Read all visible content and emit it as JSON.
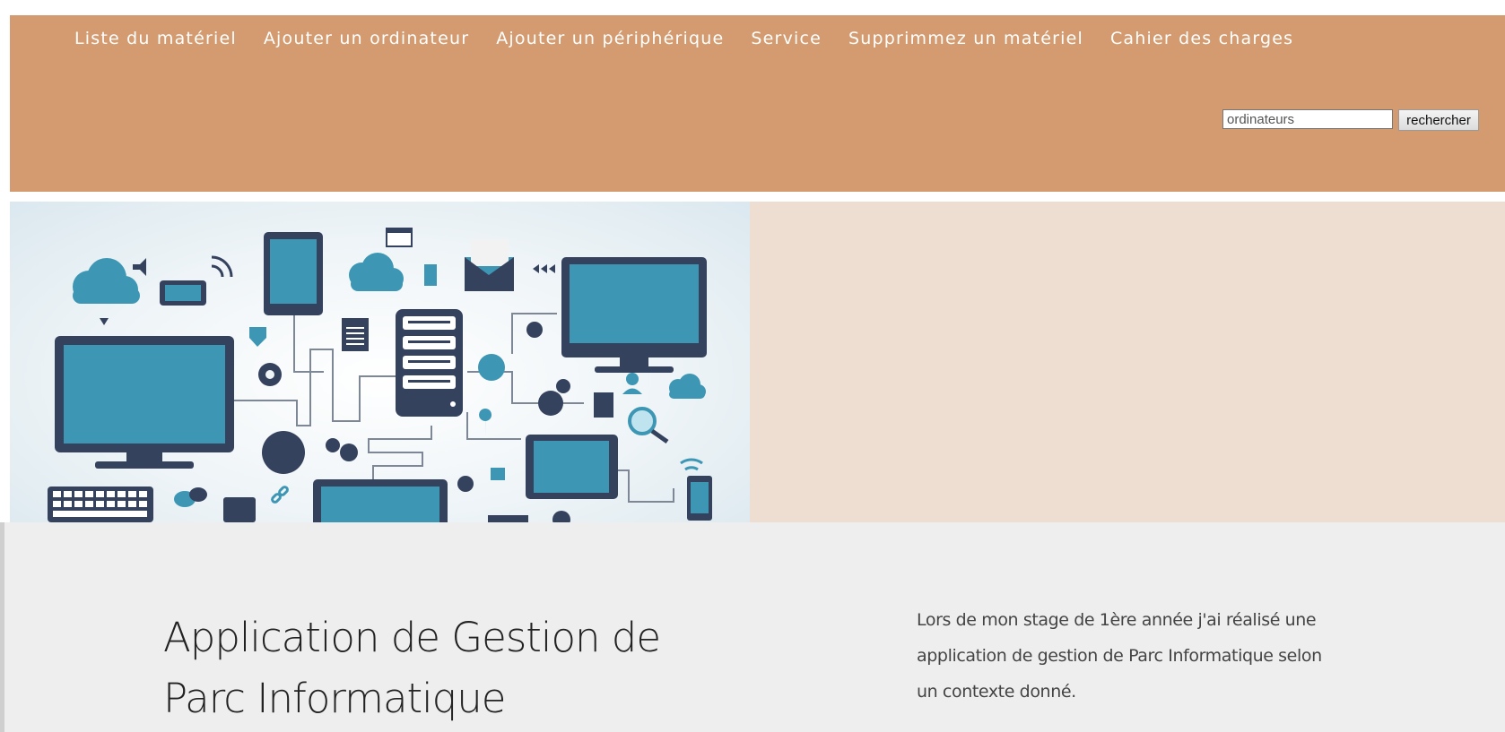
{
  "nav": {
    "items": [
      {
        "label": "Liste du matériel"
      },
      {
        "label": "Ajouter un ordinateur"
      },
      {
        "label": "Ajouter un périphérique"
      },
      {
        "label": "Service"
      },
      {
        "label": "Supprimmez un matériel"
      },
      {
        "label": "Cahier des charges"
      }
    ]
  },
  "search": {
    "value": "ordinateurs",
    "button_label": "rechercher"
  },
  "hero": {
    "image_alt_icon": "network-devices-illustration"
  },
  "content": {
    "title": "Application de Gestion de Parc Informatique",
    "description": "Lors de mon stage de 1ère année j'ai réalisé une application de gestion de Parc Informatique selon un contexte donné."
  },
  "colors": {
    "topbar": "#d39b6f",
    "hero_panel": "#eeddd1",
    "lower_bg": "#eeeeee",
    "icon_dark": "#35425e",
    "icon_teal": "#3d97b4"
  }
}
